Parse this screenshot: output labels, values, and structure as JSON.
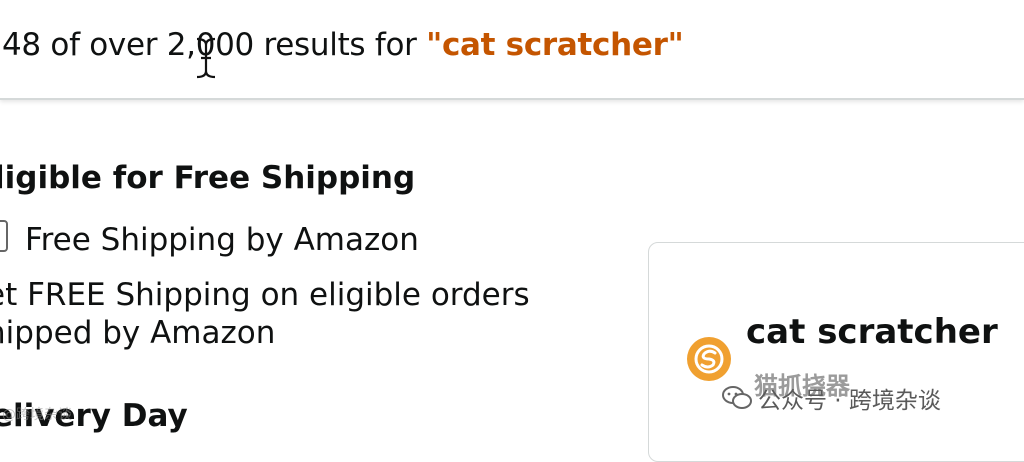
{
  "results": {
    "count_text": "48 of over 2,000 results for ",
    "query": "\"cat scratcher\""
  },
  "filters": {
    "heading": "ligible for Free Shipping",
    "checkbox_label": "Free Shipping by Amazon",
    "description": "et FREE Shipping on eligible orders hipped by Amazon",
    "next_heading": "elivery Day"
  },
  "card": {
    "title": "cat scratcher",
    "subtitle": "猫抓挠器"
  },
  "watermark": {
    "text": "公众号 · 跨境杂谈",
    "faint_text": "@跨境杂谈"
  },
  "colors": {
    "query": "#c45500",
    "logo": "#f0a030"
  },
  "icons": [
    "text-cursor-icon",
    "logo-icon",
    "wechat-icon"
  ]
}
